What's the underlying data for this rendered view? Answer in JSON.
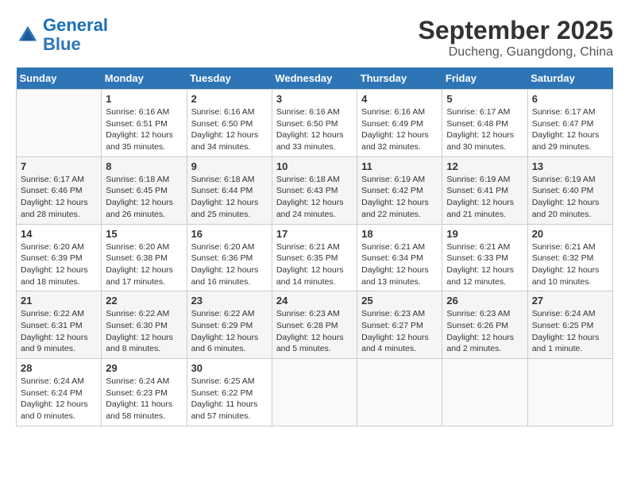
{
  "logo": {
    "line1": "General",
    "line2": "Blue"
  },
  "title": "September 2025",
  "subtitle": "Ducheng, Guangdong, China",
  "days_of_week": [
    "Sunday",
    "Monday",
    "Tuesday",
    "Wednesday",
    "Thursday",
    "Friday",
    "Saturday"
  ],
  "weeks": [
    [
      {
        "num": "",
        "info": ""
      },
      {
        "num": "1",
        "info": "Sunrise: 6:16 AM\nSunset: 6:51 PM\nDaylight: 12 hours\nand 35 minutes."
      },
      {
        "num": "2",
        "info": "Sunrise: 6:16 AM\nSunset: 6:50 PM\nDaylight: 12 hours\nand 34 minutes."
      },
      {
        "num": "3",
        "info": "Sunrise: 6:16 AM\nSunset: 6:50 PM\nDaylight: 12 hours\nand 33 minutes."
      },
      {
        "num": "4",
        "info": "Sunrise: 6:16 AM\nSunset: 6:49 PM\nDaylight: 12 hours\nand 32 minutes."
      },
      {
        "num": "5",
        "info": "Sunrise: 6:17 AM\nSunset: 6:48 PM\nDaylight: 12 hours\nand 30 minutes."
      },
      {
        "num": "6",
        "info": "Sunrise: 6:17 AM\nSunset: 6:47 PM\nDaylight: 12 hours\nand 29 minutes."
      }
    ],
    [
      {
        "num": "7",
        "info": "Sunrise: 6:17 AM\nSunset: 6:46 PM\nDaylight: 12 hours\nand 28 minutes."
      },
      {
        "num": "8",
        "info": "Sunrise: 6:18 AM\nSunset: 6:45 PM\nDaylight: 12 hours\nand 26 minutes."
      },
      {
        "num": "9",
        "info": "Sunrise: 6:18 AM\nSunset: 6:44 PM\nDaylight: 12 hours\nand 25 minutes."
      },
      {
        "num": "10",
        "info": "Sunrise: 6:18 AM\nSunset: 6:43 PM\nDaylight: 12 hours\nand 24 minutes."
      },
      {
        "num": "11",
        "info": "Sunrise: 6:19 AM\nSunset: 6:42 PM\nDaylight: 12 hours\nand 22 minutes."
      },
      {
        "num": "12",
        "info": "Sunrise: 6:19 AM\nSunset: 6:41 PM\nDaylight: 12 hours\nand 21 minutes."
      },
      {
        "num": "13",
        "info": "Sunrise: 6:19 AM\nSunset: 6:40 PM\nDaylight: 12 hours\nand 20 minutes."
      }
    ],
    [
      {
        "num": "14",
        "info": "Sunrise: 6:20 AM\nSunset: 6:39 PM\nDaylight: 12 hours\nand 18 minutes."
      },
      {
        "num": "15",
        "info": "Sunrise: 6:20 AM\nSunset: 6:38 PM\nDaylight: 12 hours\nand 17 minutes."
      },
      {
        "num": "16",
        "info": "Sunrise: 6:20 AM\nSunset: 6:36 PM\nDaylight: 12 hours\nand 16 minutes."
      },
      {
        "num": "17",
        "info": "Sunrise: 6:21 AM\nSunset: 6:35 PM\nDaylight: 12 hours\nand 14 minutes."
      },
      {
        "num": "18",
        "info": "Sunrise: 6:21 AM\nSunset: 6:34 PM\nDaylight: 12 hours\nand 13 minutes."
      },
      {
        "num": "19",
        "info": "Sunrise: 6:21 AM\nSunset: 6:33 PM\nDaylight: 12 hours\nand 12 minutes."
      },
      {
        "num": "20",
        "info": "Sunrise: 6:21 AM\nSunset: 6:32 PM\nDaylight: 12 hours\nand 10 minutes."
      }
    ],
    [
      {
        "num": "21",
        "info": "Sunrise: 6:22 AM\nSunset: 6:31 PM\nDaylight: 12 hours\nand 9 minutes."
      },
      {
        "num": "22",
        "info": "Sunrise: 6:22 AM\nSunset: 6:30 PM\nDaylight: 12 hours\nand 8 minutes."
      },
      {
        "num": "23",
        "info": "Sunrise: 6:22 AM\nSunset: 6:29 PM\nDaylight: 12 hours\nand 6 minutes."
      },
      {
        "num": "24",
        "info": "Sunrise: 6:23 AM\nSunset: 6:28 PM\nDaylight: 12 hours\nand 5 minutes."
      },
      {
        "num": "25",
        "info": "Sunrise: 6:23 AM\nSunset: 6:27 PM\nDaylight: 12 hours\nand 4 minutes."
      },
      {
        "num": "26",
        "info": "Sunrise: 6:23 AM\nSunset: 6:26 PM\nDaylight: 12 hours\nand 2 minutes."
      },
      {
        "num": "27",
        "info": "Sunrise: 6:24 AM\nSunset: 6:25 PM\nDaylight: 12 hours\nand 1 minute."
      }
    ],
    [
      {
        "num": "28",
        "info": "Sunrise: 6:24 AM\nSunset: 6:24 PM\nDaylight: 12 hours\nand 0 minutes."
      },
      {
        "num": "29",
        "info": "Sunrise: 6:24 AM\nSunset: 6:23 PM\nDaylight: 11 hours\nand 58 minutes."
      },
      {
        "num": "30",
        "info": "Sunrise: 6:25 AM\nSunset: 6:22 PM\nDaylight: 11 hours\nand 57 minutes."
      },
      {
        "num": "",
        "info": ""
      },
      {
        "num": "",
        "info": ""
      },
      {
        "num": "",
        "info": ""
      },
      {
        "num": "",
        "info": ""
      }
    ]
  ]
}
